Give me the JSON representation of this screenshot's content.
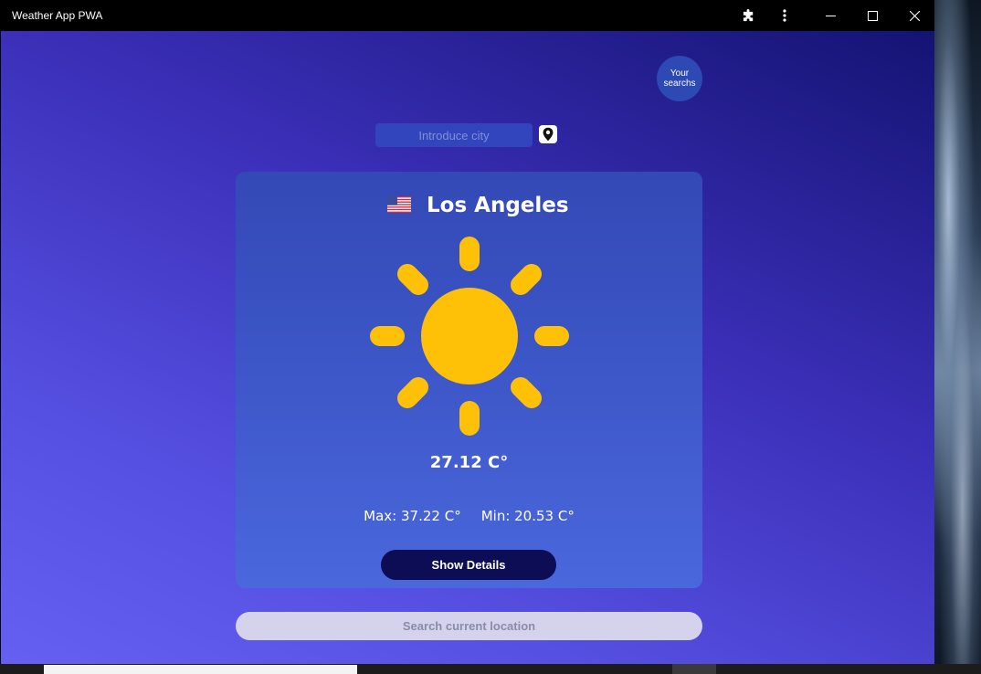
{
  "window": {
    "title": "Weather App PWA",
    "controls": {
      "extensions_icon": "puzzle-icon",
      "more_icon": "more-vertical-icon",
      "minimize_icon": "minimize-icon",
      "maximize_icon": "maximize-icon",
      "close_icon": "close-icon"
    }
  },
  "header": {
    "your_searches_line1": "Your",
    "your_searches_line2": "searchs"
  },
  "search": {
    "placeholder": "Introduce city",
    "value": "",
    "locate_icon": "map-pin-icon"
  },
  "weather": {
    "country_flag": "us-flag",
    "city": "Los Angeles",
    "condition_icon": "sun-icon",
    "temperature": "27.12 C°",
    "max": "Max: 37.22 C°",
    "min": "Min: 20.53 C°",
    "details_button": "Show Details"
  },
  "footer": {
    "current_location_button": "Search current location"
  },
  "colors": {
    "sun": "#FFC107",
    "card": "#3F59CB",
    "details_button": "#0C0D55"
  }
}
